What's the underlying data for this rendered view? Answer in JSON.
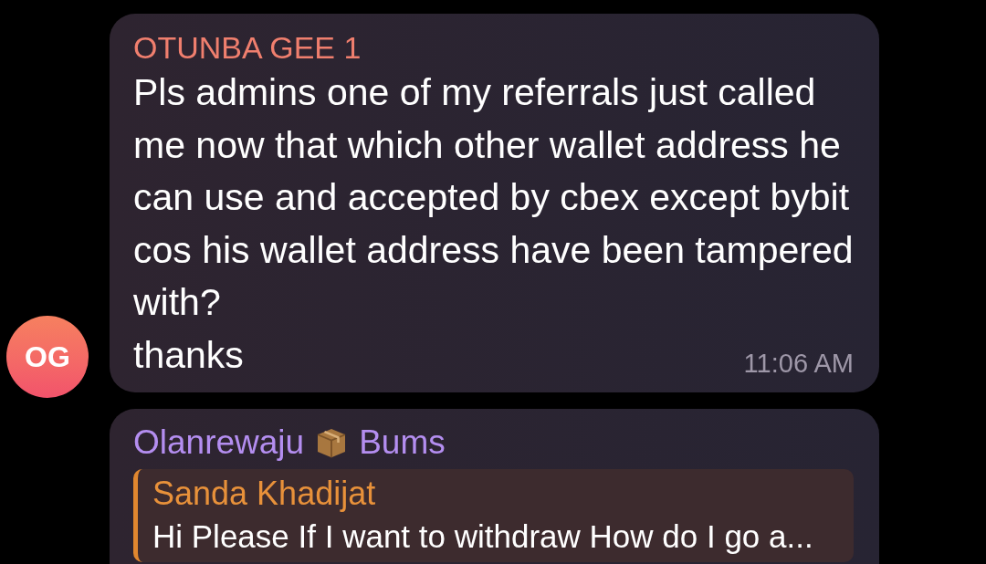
{
  "messages": [
    {
      "kind": "text",
      "sender": "OTUNBA GEE 1",
      "avatar": {
        "initials": "OG"
      },
      "paragraphs": [
        "Pls admins one of my referrals just called me now that which other wallet address he can use and accepted by cbex except bybit cos his wallet address have been tampered with?",
        "thanks"
      ],
      "time": "11:06 AM"
    },
    {
      "kind": "reply",
      "sender_parts": [
        "Olanrewaju",
        "Bums"
      ],
      "reply": {
        "name": "Sanda Khadijat",
        "text": "Hi Please If I want to withdraw How do I go a..."
      }
    }
  ]
}
